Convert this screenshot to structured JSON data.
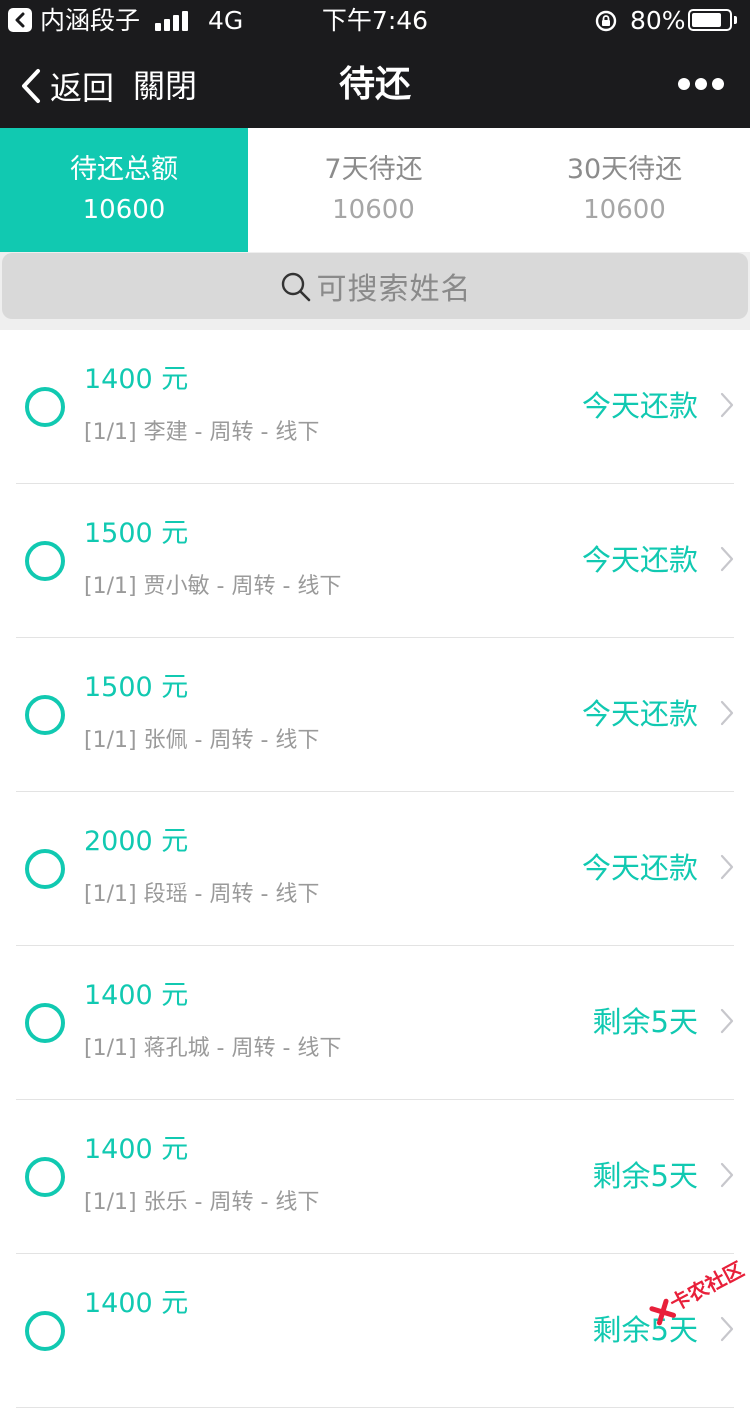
{
  "status_bar": {
    "app_name": "内涵段子",
    "network": "4G",
    "time": "下午7:46",
    "battery_percent_label": "80%",
    "battery_level": 0.8
  },
  "nav": {
    "back_label": "返回",
    "close_label": "關閉",
    "title": "待还"
  },
  "tabs": [
    {
      "label": "待还总额",
      "value": "10600",
      "active": true
    },
    {
      "label": "7天待还",
      "value": "10600",
      "active": false
    },
    {
      "label": "30天待还",
      "value": "10600",
      "active": false
    }
  ],
  "search": {
    "placeholder": "可搜索姓名"
  },
  "records": [
    {
      "amount": "1400 元",
      "desc": "[1/1] 李建 - 周转 - 线下",
      "status": "今天还款"
    },
    {
      "amount": "1500 元",
      "desc": "[1/1] 贾小敏 - 周转 - 线下",
      "status": "今天还款"
    },
    {
      "amount": "1500 元",
      "desc": "[1/1] 张佩 - 周转 - 线下",
      "status": "今天还款"
    },
    {
      "amount": "2000 元",
      "desc": "[1/1] 段瑶 - 周转 - 线下",
      "status": "今天还款"
    },
    {
      "amount": "1400 元",
      "desc": "[1/1] 蒋孔城 - 周转 - 线下",
      "status": "剩余5天"
    },
    {
      "amount": "1400 元",
      "desc": "[1/1] 张乐 - 周转 - 线下",
      "status": "剩余5天"
    },
    {
      "amount": "1400 元",
      "desc": "",
      "status": "剩余5天"
    }
  ],
  "watermark": {
    "text": "卡农社区"
  },
  "colors": {
    "accent": "#11c9b1",
    "header_bg": "#1b1b1d",
    "watermark": "#e8203a"
  }
}
